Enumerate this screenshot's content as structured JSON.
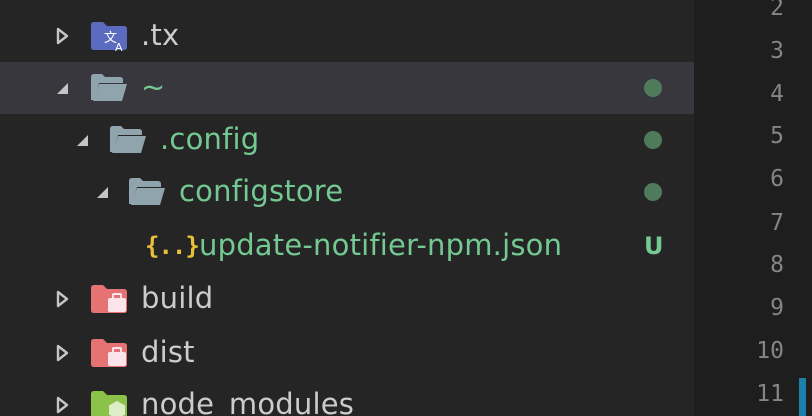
{
  "colors": {
    "git_added": "#73c991",
    "git_dot": "#4f7a5b",
    "json_icon": "#e8c03a",
    "gutter_mark": "#1b81a8"
  },
  "tree": [
    {
      "label": ".tx",
      "icon": "folder-translation-icon",
      "expanded": false,
      "git": false
    },
    {
      "label": "~",
      "icon": "folder-open-icon",
      "expanded": true,
      "git": true,
      "status": "modified-dot",
      "selected": true
    },
    {
      "label": ".config",
      "icon": "folder-open-icon",
      "expanded": true,
      "git": true,
      "status": "modified-dot"
    },
    {
      "label": "configstore",
      "icon": "folder-open-icon",
      "expanded": true,
      "git": true,
      "status": "modified-dot"
    },
    {
      "label": "update-notifier-npm.json",
      "icon": "json-file-icon",
      "git": true,
      "status": "U",
      "json_glyph": "{..}"
    },
    {
      "label": "build",
      "icon": "folder-build-icon",
      "expanded": false,
      "git": false
    },
    {
      "label": "dist",
      "icon": "folder-dist-icon",
      "expanded": false,
      "git": false
    },
    {
      "label": "node_modules",
      "icon": "folder-node-icon",
      "expanded": false,
      "git": false
    }
  ],
  "line_numbers": [
    "2",
    "3",
    "4",
    "5",
    "6",
    "7",
    "8",
    "9",
    "10",
    "11"
  ]
}
